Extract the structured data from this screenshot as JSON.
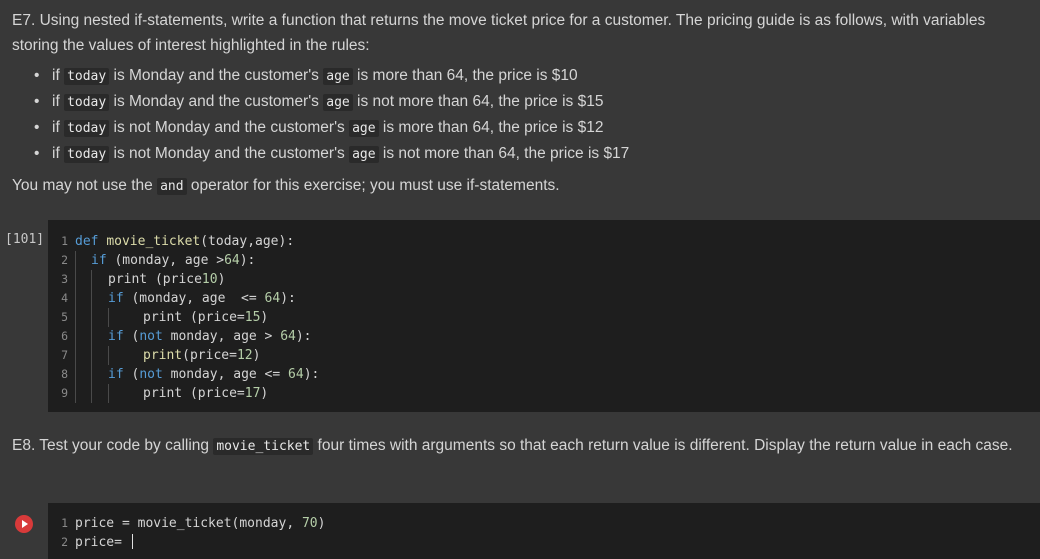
{
  "e7": {
    "intro": "E7. Using nested if-statements, write a function that returns the move ticket price for a customer. The pricing guide is as follows, with variables storing the values of interest highlighted in the rules:",
    "rules": [
      {
        "p1": "if ",
        "c1": "today",
        "p2": " is Monday and the customer's ",
        "c2": "age",
        "p3": " is more than 64, the price is $10"
      },
      {
        "p1": "if ",
        "c1": "today",
        "p2": " is Monday and the customer's ",
        "c2": "age",
        "p3": " is not more than 64, the price is $15"
      },
      {
        "p1": "if ",
        "c1": "today",
        "p2": " is not Monday and the customer's ",
        "c2": "age",
        "p3": " is more than 64, the price is $12"
      },
      {
        "p1": "if ",
        "c1": "today",
        "p2": " is not Monday and the customer's ",
        "c2": "age",
        "p3": " is not more than 64, the price is $17"
      }
    ],
    "note_before": "You may not use the ",
    "note_code": "and",
    "note_after": " operator for this exercise; you must use if-statements."
  },
  "cell1": {
    "exec_count": "[101]",
    "line_numbers": [
      "1",
      "2",
      "3",
      "4",
      "5",
      "6",
      "7",
      "8",
      "9"
    ],
    "l1": {
      "kw": "def",
      "fn": "movie_ticket",
      "p1": "(today,age):"
    },
    "l2": {
      "kw": "if",
      "p1": " (monday, age >",
      "num": "64",
      "p2": "):"
    },
    "l3": {
      "p1": "print (price",
      "num": "10",
      "p2": ")"
    },
    "l4": {
      "kw": "if",
      "p1": " (monday, age  <= ",
      "num": "64",
      "p2": "):"
    },
    "l5": {
      "p1": "print (price=",
      "num": "15",
      "p2": ")"
    },
    "l6": {
      "kw": "if",
      "p1": " (",
      "kw2": "not",
      "p2": " monday, age > ",
      "num": "64",
      "p3": "):"
    },
    "l7": {
      "fn": "print",
      "p1": "(price=",
      "num": "12",
      "p2": ")"
    },
    "l8": {
      "kw": "if",
      "p1": " (",
      "kw2": "not",
      "p2": " monday, age <= ",
      "num": "64",
      "p3": "):"
    },
    "l9": {
      "p1": "print (price=",
      "num": "17",
      "p2": ")"
    }
  },
  "e8": {
    "before": "E8. Test your code by calling ",
    "code": "movie_ticket",
    "after": " four times with arguments so that each return value is different. Display the return value in each case."
  },
  "cell2": {
    "line_numbers": [
      "1",
      "2"
    ],
    "l1": {
      "p1": "price = movie_ticket(monday, ",
      "num": "70",
      "p2": ")"
    },
    "l2": {
      "p1": "price= "
    }
  }
}
